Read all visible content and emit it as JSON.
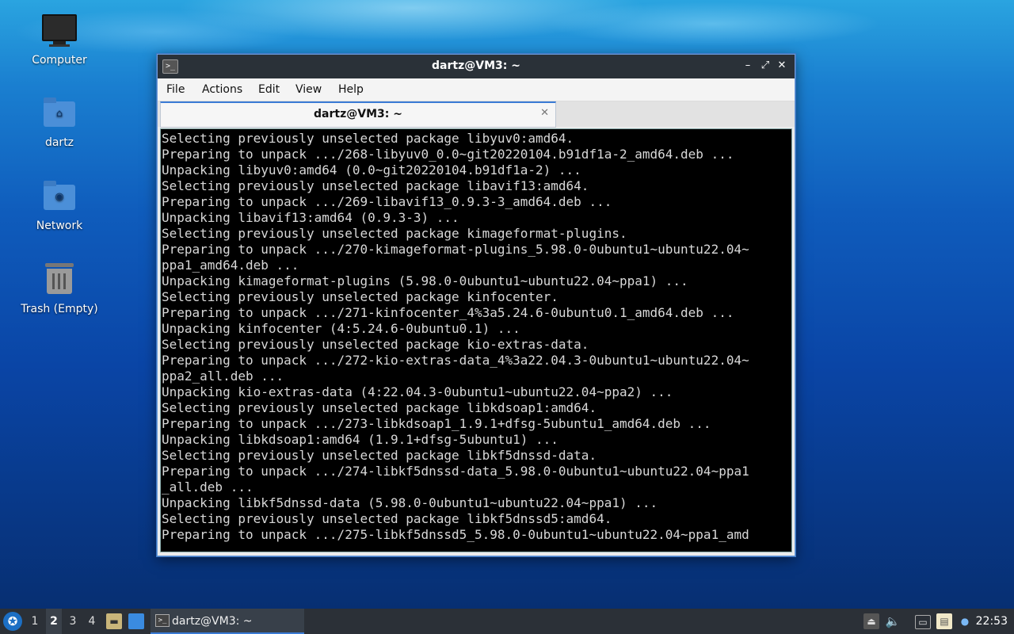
{
  "desktop": {
    "icons": [
      {
        "label": "Computer"
      },
      {
        "label": "dartz"
      },
      {
        "label": "Network"
      },
      {
        "label": "Trash (Empty)"
      }
    ]
  },
  "window": {
    "title": "dartz@VM3: ~",
    "icon": "terminal-icon",
    "controls": {
      "minimize": "–",
      "maximize": "⤢",
      "close": "✕"
    },
    "menu": [
      "File",
      "Actions",
      "Edit",
      "View",
      "Help"
    ],
    "tab": {
      "label": "dartz@VM3: ~",
      "close": "✕"
    }
  },
  "terminal": {
    "lines": [
      "Selecting previously unselected package libyuv0:amd64.",
      "Preparing to unpack .../268-libyuv0_0.0~git20220104.b91df1a-2_amd64.deb ...",
      "Unpacking libyuv0:amd64 (0.0~git20220104.b91df1a-2) ...",
      "Selecting previously unselected package libavif13:amd64.",
      "Preparing to unpack .../269-libavif13_0.9.3-3_amd64.deb ...",
      "Unpacking libavif13:amd64 (0.9.3-3) ...",
      "Selecting previously unselected package kimageformat-plugins.",
      "Preparing to unpack .../270-kimageformat-plugins_5.98.0-0ubuntu1~ubuntu22.04~",
      "ppa1_amd64.deb ...",
      "Unpacking kimageformat-plugins (5.98.0-0ubuntu1~ubuntu22.04~ppa1) ...",
      "Selecting previously unselected package kinfocenter.",
      "Preparing to unpack .../271-kinfocenter_4%3a5.24.6-0ubuntu0.1_amd64.deb ...",
      "Unpacking kinfocenter (4:5.24.6-0ubuntu0.1) ...",
      "Selecting previously unselected package kio-extras-data.",
      "Preparing to unpack .../272-kio-extras-data_4%3a22.04.3-0ubuntu1~ubuntu22.04~",
      "ppa2_all.deb ...",
      "Unpacking kio-extras-data (4:22.04.3-0ubuntu1~ubuntu22.04~ppa2) ...",
      "Selecting previously unselected package libkdsoap1:amd64.",
      "Preparing to unpack .../273-libkdsoap1_1.9.1+dfsg-5ubuntu1_amd64.deb ...",
      "Unpacking libkdsoap1:amd64 (1.9.1+dfsg-5ubuntu1) ...",
      "Selecting previously unselected package libkf5dnssd-data.",
      "Preparing to unpack .../274-libkf5dnssd-data_5.98.0-0ubuntu1~ubuntu22.04~ppa1",
      "_all.deb ...",
      "Unpacking libkf5dnssd-data (5.98.0-0ubuntu1~ubuntu22.04~ppa1) ...",
      "Selecting previously unselected package libkf5dnssd5:amd64.",
      "Preparing to unpack .../275-libkf5dnssd5_5.98.0-0ubuntu1~ubuntu22.04~ppa1_amd"
    ]
  },
  "taskbar": {
    "start_icon": "lubuntu-logo-icon",
    "workspaces": [
      "1",
      "2",
      "3",
      "4"
    ],
    "active_workspace": "2",
    "quicklaunch": [
      "file-manager-icon",
      "show-desktop-icon"
    ],
    "task": {
      "label": "dartz@VM3: ~"
    },
    "tray": [
      "eject-icon",
      "volume-icon",
      "network-icon",
      "clipboard-icon",
      "update-notifier-icon"
    ],
    "clock": "22:53"
  }
}
